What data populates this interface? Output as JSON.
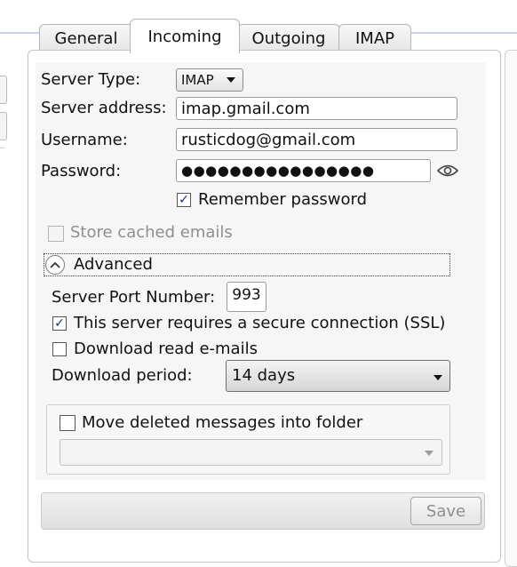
{
  "tabs": [
    {
      "label": "General",
      "active": false
    },
    {
      "label": "Incoming",
      "active": true
    },
    {
      "label": "Outgoing",
      "active": false
    },
    {
      "label": "IMAP",
      "active": false
    }
  ],
  "form": {
    "server_type_label": "Server Type:",
    "server_type_value": "IMAP",
    "server_address_label": "Server address:",
    "server_address_value": "imap.gmail.com",
    "username_label": "Username:",
    "username_value": "rusticdog@gmail.com",
    "password_label": "Password:",
    "password_value": "●●●●●●●●●●●●●●●●",
    "remember_password_label": "Remember password",
    "remember_password_checked": true,
    "store_cached_label": "Store cached emails",
    "store_cached_checked": false
  },
  "advanced": {
    "label": "Advanced",
    "expanded": true,
    "port_label": "Server Port Number:",
    "port_value": "993",
    "ssl_label": "This server requires a secure connection (SSL)",
    "ssl_checked": true,
    "download_read_label": "Download read e-mails",
    "download_read_checked": false,
    "download_period_label": "Download period:",
    "download_period_value": "14 days",
    "move_deleted_label": "Move deleted messages into folder",
    "move_deleted_checked": false,
    "folder_value": ""
  },
  "footer": {
    "save_label": "Save"
  },
  "glyphs": {
    "check": "✓",
    "chevron_up": "︿"
  },
  "colors": {
    "check": "#1b2b7a",
    "disabled_text": "#8f8f8f"
  }
}
